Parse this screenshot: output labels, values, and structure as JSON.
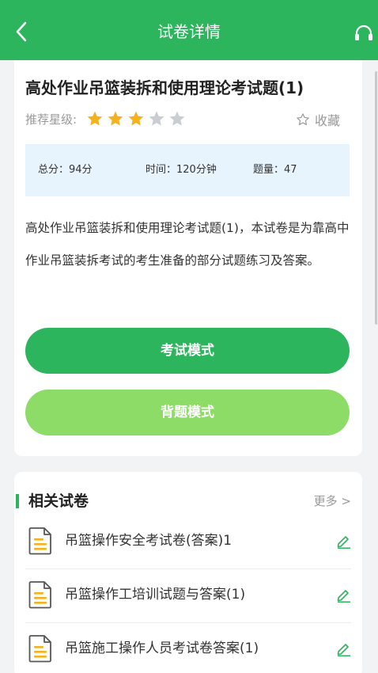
{
  "header": {
    "title": "试卷详情",
    "back_icon": "chevron-left-icon",
    "action_icon": "headset-icon"
  },
  "paper": {
    "title": "高处作业吊篮装拆和使用理论考试题(1)",
    "rating_label": "推荐星级:",
    "rating": 3,
    "rating_max": 5,
    "favorite_label": "收藏",
    "stats": {
      "score": "总分：94分",
      "time": "时间：120分钟",
      "count": "题量：47"
    },
    "description": "高处作业吊篮装拆和使用理论考试题(1)，本试卷是为靠高中作业吊篮装拆考试的考生准备的部分试题练习及答案。"
  },
  "buttons": {
    "exam_mode": "考试模式",
    "recite_mode": "背题模式"
  },
  "related": {
    "title": "相关试卷",
    "more": "更多 >",
    "items": [
      {
        "label": "吊篮操作安全考试卷(答案)1"
      },
      {
        "label": "吊篮操作工培训试题与答案(1)"
      },
      {
        "label": "吊篮施工操作人员考试卷答案(1)"
      }
    ]
  },
  "colors": {
    "primary": "#2db55d",
    "secondary": "#8ddc67",
    "star_on": "#f5b21c",
    "star_off": "#c9ccd1",
    "stats_bg": "#e8f4fd"
  }
}
